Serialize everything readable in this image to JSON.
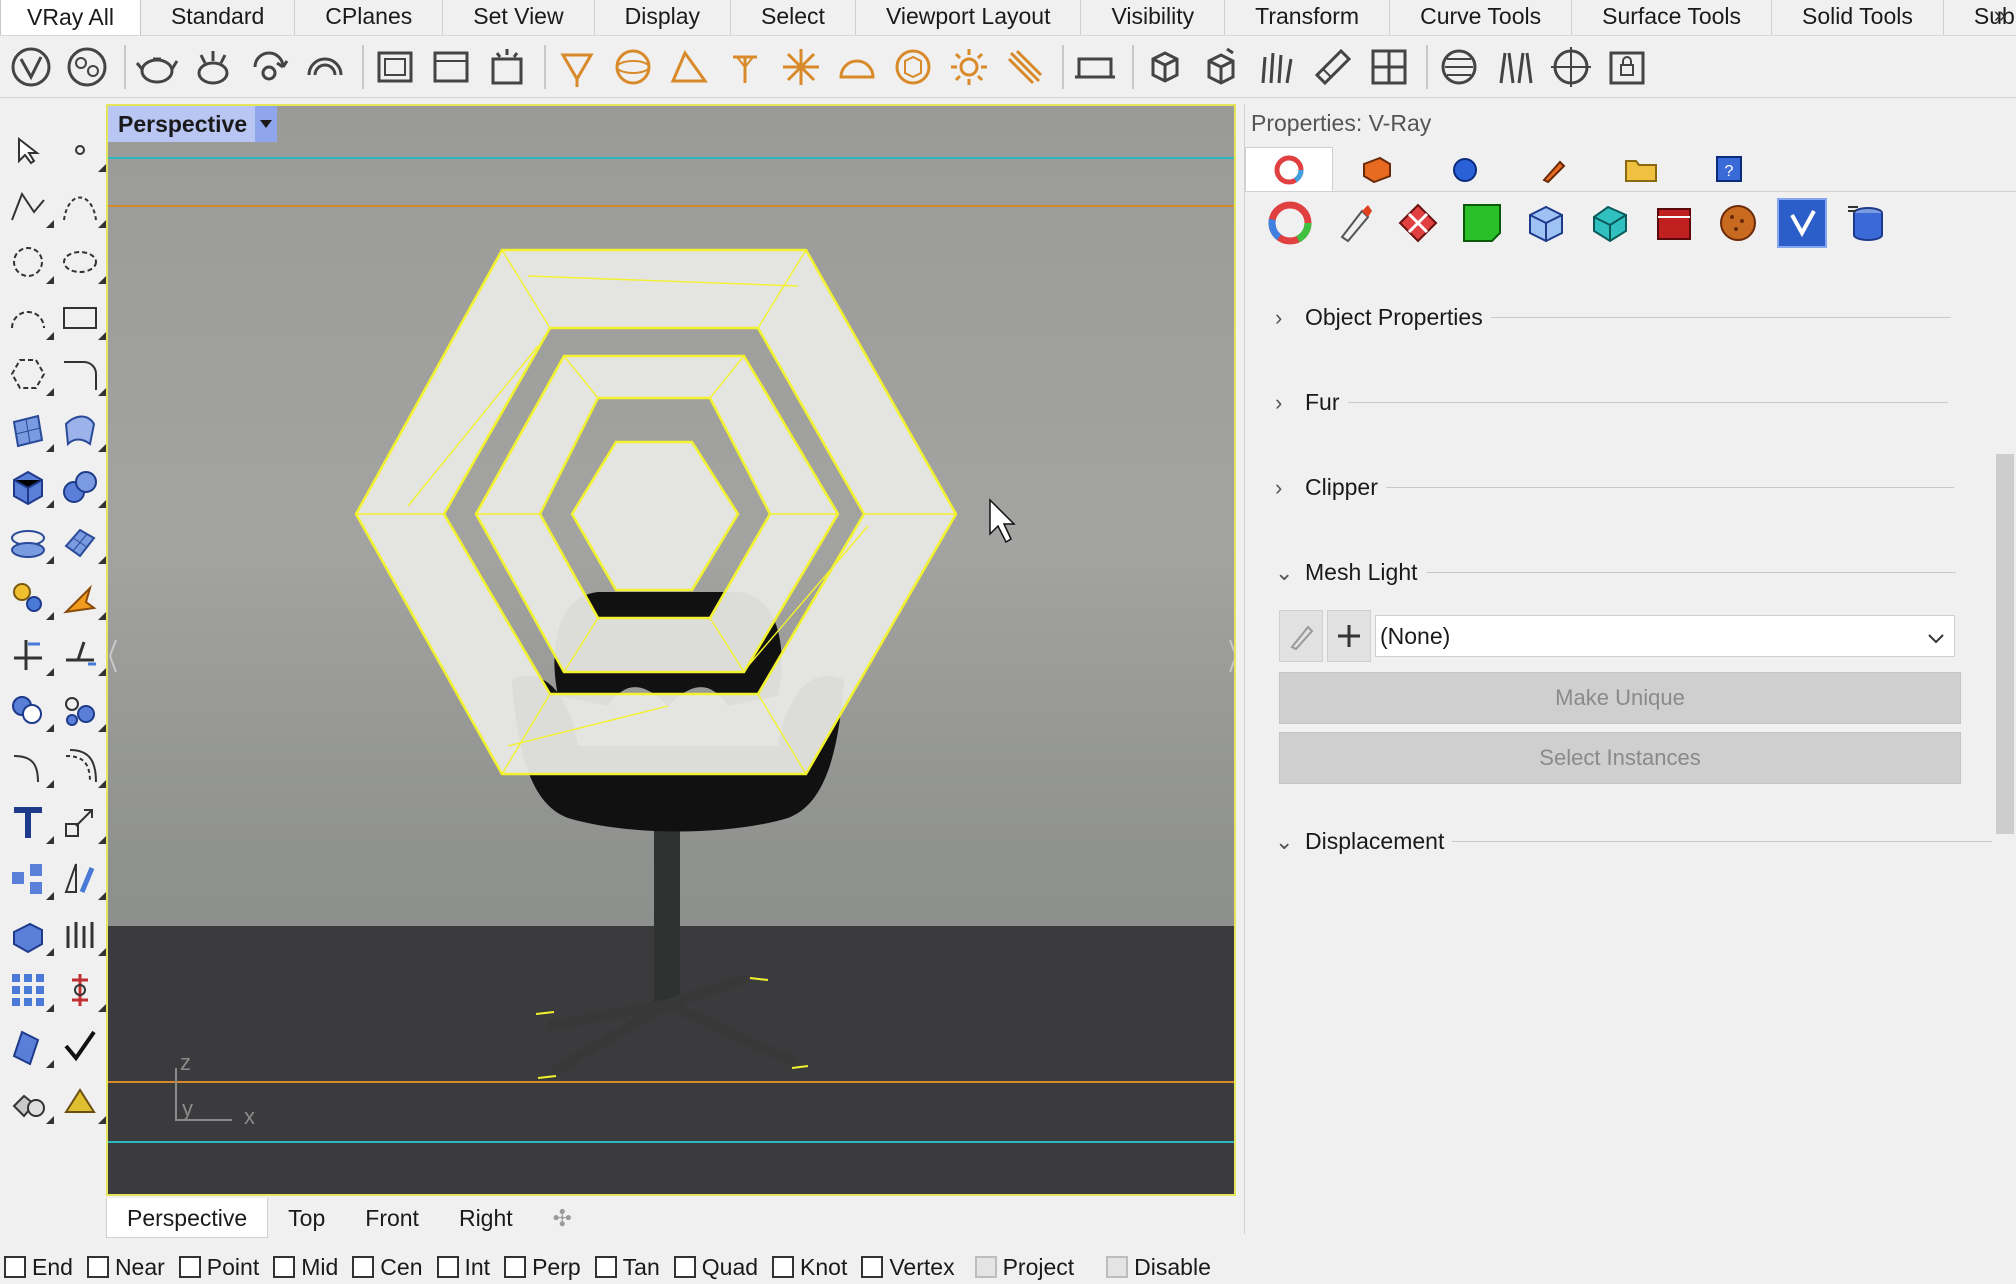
{
  "tabs": [
    "VRay All",
    "Standard",
    "CPlanes",
    "Set View",
    "Display",
    "Select",
    "Viewport Layout",
    "Visibility",
    "Transform",
    "Curve Tools",
    "Surface Tools",
    "Solid Tools",
    "SubD Too"
  ],
  "tabs_more": "»",
  "viewport": {
    "title": "Perspective",
    "axis_labels": {
      "z": "z",
      "y": "y",
      "x": "x"
    }
  },
  "viewport_tabs": [
    "Perspective",
    "Top",
    "Front",
    "Right"
  ],
  "panel": {
    "title": "Properties: V-Ray",
    "sections": {
      "object_properties": "Object Properties",
      "fur": "Fur",
      "clipper": "Clipper",
      "mesh_light": "Mesh Light",
      "displacement": "Displacement"
    },
    "mesh_light_select": "(None)",
    "make_unique": "Make Unique",
    "select_instances": "Select Instances"
  },
  "osnaps": [
    "End",
    "Near",
    "Point",
    "Mid",
    "Cen",
    "Int",
    "Perp",
    "Tan",
    "Quad",
    "Knot",
    "Vertex"
  ],
  "osnaps_disabled": [
    "Project",
    "Disable"
  ],
  "colors": {
    "selection": "#f2f230",
    "viewport_title_bg": "#b9c6f3",
    "vray_active": "#2b5ec8"
  }
}
